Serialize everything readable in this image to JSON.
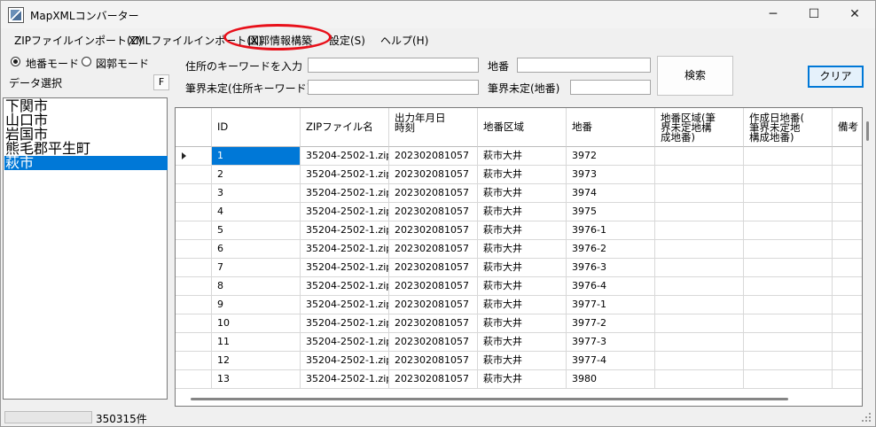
{
  "window": {
    "title": "MapXMLコンバーター",
    "icon": "map-app-icon",
    "controls": {
      "minimize": "─",
      "maximize": "☐",
      "close": "✕"
    }
  },
  "menu": [
    {
      "label": "ZIPファイルインポート(Z)"
    },
    {
      "label": "XMLファイルインポート(X)"
    },
    {
      "label": "図郭情報構築"
    },
    {
      "label": "設定(S)"
    },
    {
      "label": "ヘルプ(H)"
    }
  ],
  "mode": {
    "chiban_label": "地番モード",
    "zukaku_label": "図郭モード",
    "selected": "地番モード"
  },
  "data_select": {
    "label": "データ選択",
    "button": "F"
  },
  "cities": [
    {
      "name": "下関市",
      "selected": false
    },
    {
      "name": "山口市",
      "selected": false
    },
    {
      "name": "岩国市",
      "selected": false
    },
    {
      "name": "熊毛郡平生町",
      "selected": false
    },
    {
      "name": "萩市",
      "selected": true
    }
  ],
  "search": {
    "address_keyword_label": "住所のキーワードを入力",
    "address_keyword_value": "",
    "chiban_label": "地番",
    "chiban_value": "",
    "undetermined_address_label": "筆界未定(住所キーワード)",
    "undetermined_address_value": "",
    "undetermined_chiban_label": "筆界未定(地番)",
    "undetermined_chiban_value": "",
    "search_button": "検索",
    "clear_button": "クリア"
  },
  "grid": {
    "columns": [
      "ID",
      "ZIPファイル名",
      "出力年月日\n時刻",
      "地番区域",
      "地番",
      "地番区域(筆\n界未定地構\n成地番)",
      "作成日地番(\n筆界未定地\n構成地番)",
      "備考"
    ],
    "rows": [
      [
        "1",
        "35204-2502-1.zip",
        "202302081057",
        "萩市大井",
        "3972",
        "",
        "",
        ""
      ],
      [
        "2",
        "35204-2502-1.zip",
        "202302081057",
        "萩市大井",
        "3973",
        "",
        "",
        ""
      ],
      [
        "3",
        "35204-2502-1.zip",
        "202302081057",
        "萩市大井",
        "3974",
        "",
        "",
        ""
      ],
      [
        "4",
        "35204-2502-1.zip",
        "202302081057",
        "萩市大井",
        "3975",
        "",
        "",
        ""
      ],
      [
        "5",
        "35204-2502-1.zip",
        "202302081057",
        "萩市大井",
        "3976-1",
        "",
        "",
        ""
      ],
      [
        "6",
        "35204-2502-1.zip",
        "202302081057",
        "萩市大井",
        "3976-2",
        "",
        "",
        ""
      ],
      [
        "7",
        "35204-2502-1.zip",
        "202302081057",
        "萩市大井",
        "3976-3",
        "",
        "",
        ""
      ],
      [
        "8",
        "35204-2502-1.zip",
        "202302081057",
        "萩市大井",
        "3976-4",
        "",
        "",
        ""
      ],
      [
        "9",
        "35204-2502-1.zip",
        "202302081057",
        "萩市大井",
        "3977-1",
        "",
        "",
        ""
      ],
      [
        "10",
        "35204-2502-1.zip",
        "202302081057",
        "萩市大井",
        "3977-2",
        "",
        "",
        ""
      ],
      [
        "11",
        "35204-2502-1.zip",
        "202302081057",
        "萩市大井",
        "3977-3",
        "",
        "",
        ""
      ],
      [
        "12",
        "35204-2502-1.zip",
        "202302081057",
        "萩市大井",
        "3977-4",
        "",
        "",
        ""
      ],
      [
        "13",
        "35204-2502-1.zip",
        "202302081057",
        "萩市大井",
        "3980",
        "",
        "",
        ""
      ]
    ],
    "current_row_index": 0
  },
  "status": {
    "count": "350315件",
    "progress": 0
  },
  "colors": {
    "selection": "#0078d7",
    "highlight_ring": "#e8101a",
    "window_bg": "#f0f0f0"
  }
}
